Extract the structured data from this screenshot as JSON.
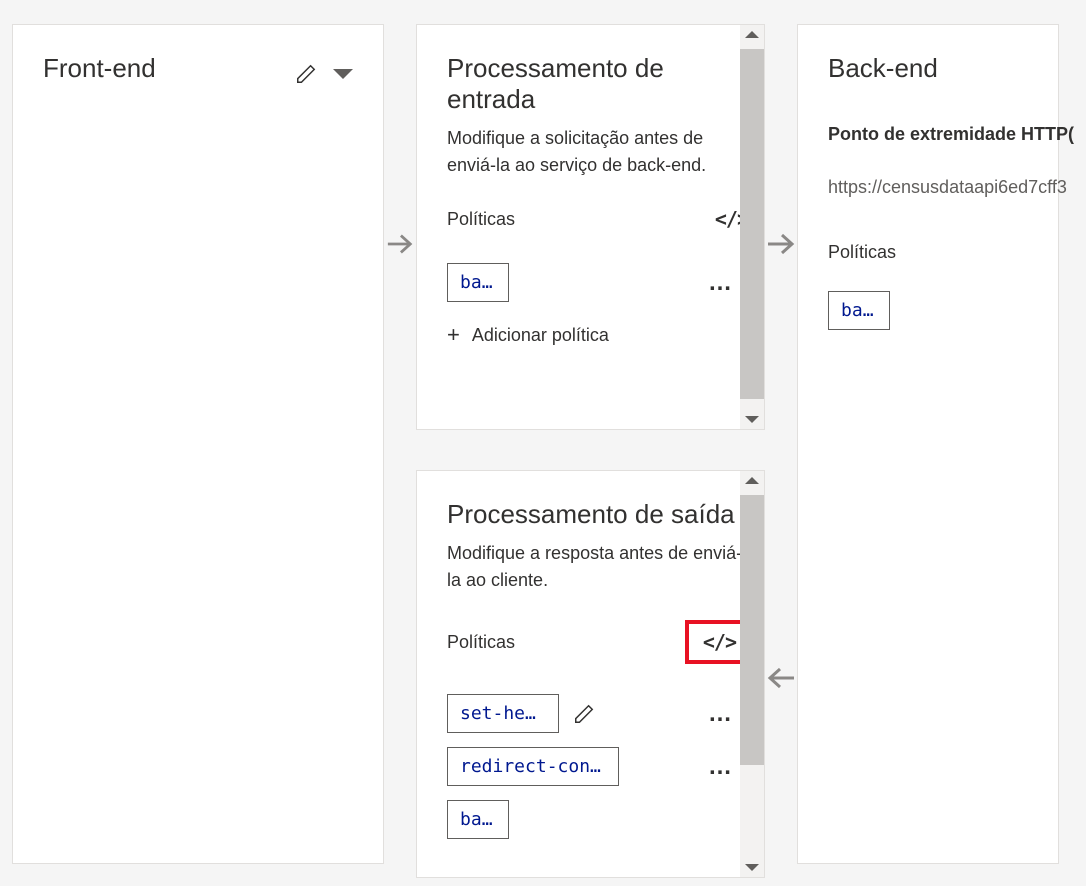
{
  "frontend": {
    "title": "Front-end"
  },
  "inbound": {
    "title": "Processamento de entrada",
    "subtitle": "Modifique a solicitação antes de enviá-la ao serviço de back-end.",
    "policies_label": "Políticas",
    "policies": [
      {
        "name": "base"
      }
    ],
    "add_policy_label": "Adicionar política"
  },
  "outbound": {
    "title": "Processamento de saída",
    "subtitle": "Modifique a resposta antes de enviá-la ao cliente.",
    "policies_label": "Políticas",
    "policies": [
      {
        "name": "set-head…"
      },
      {
        "name": "redirect-conte…"
      },
      {
        "name": "base"
      }
    ]
  },
  "backend": {
    "title": "Back-end",
    "endpoint_label": "Ponto de extremidade HTTP(",
    "endpoint_url": "https://censusdataapi6ed7cff3",
    "policies_label": "Políticas",
    "policies": [
      {
        "name": "base"
      }
    ]
  },
  "icons": {
    "code": "</>",
    "plus": "+"
  }
}
